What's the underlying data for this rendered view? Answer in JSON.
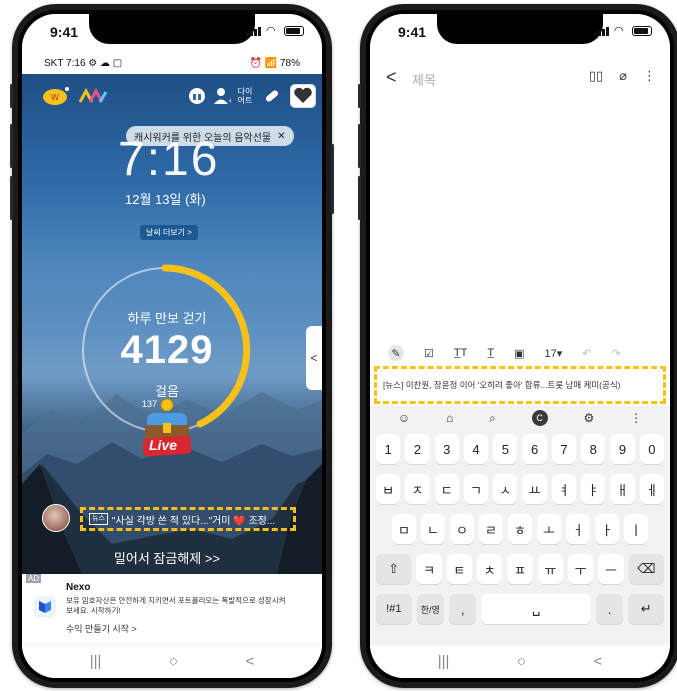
{
  "left_phone": {
    "ios_time": "9:41",
    "android_status_left": "SKT 7:16 ⚙ ☁ ▢",
    "android_status_right": "⏰ 📶 78%",
    "top_icons": [
      "cashwalk-logo-icon",
      "brand-icon",
      "gift-icon",
      "person-icon",
      "diet-label",
      "pill-icon",
      "heart-icon"
    ],
    "diet_label": "다이\n어트",
    "tooltip": "캐시워커를 위한 오늘의 음악선물",
    "tooltip_close": "✕",
    "clock": "7:16",
    "date": "12월 13일 (화)",
    "weather_button": "날씨 더보기 >",
    "walk_title": "하루 만보 걷기",
    "steps": "4129",
    "unit": "걸음",
    "minor_count": "137",
    "live_label": "Live",
    "news_tag": "뉴스",
    "news_text": "\"사실 각방 쓴 적 있다...\"거미 ❤️ 조정...",
    "unlock": "밀어서 잠금해제 >>",
    "ad_badge": "AD",
    "ad_title": "Nexo",
    "ad_text": "보유 암호자산은 안전하게 지키면서 포트폴리오는 폭발적으로 성장시켜 보세요. 시작하기!",
    "ad_cta": "수익 만들기 시작 >",
    "nav": [
      "|||",
      "○",
      "<"
    ]
  },
  "right_phone": {
    "ios_time": "9:41",
    "title_placeholder": "제목",
    "back": "<",
    "header_icons": [
      "book-icon",
      "attach-icon",
      "more-icon"
    ],
    "format_bar": [
      "pen-icon",
      "checkbox-icon",
      "text-style-icon",
      "underline-icon",
      "textbox-icon",
      "17▾",
      "undo-icon",
      "redo-icon"
    ],
    "font_size": "17▾",
    "draft_text": "[뉴스] 이찬원, 장윤정 이어 '오히려 좋아' 합류...트롯 남매 케미(공식)",
    "keyboard_tools": [
      "☺",
      "⌂",
      "⌕",
      "C",
      "⚙",
      "⋮"
    ],
    "row1": [
      "1",
      "2",
      "3",
      "4",
      "5",
      "6",
      "7",
      "8",
      "9",
      "0"
    ],
    "row2": [
      "ㅂ",
      "ㅈ",
      "ㄷ",
      "ㄱ",
      "ㅅ",
      "ㅛ",
      "ㅕ",
      "ㅑ",
      "ㅐ",
      "ㅔ"
    ],
    "row3": [
      "ㅁ",
      "ㄴ",
      "ㅇ",
      "ㄹ",
      "ㅎ",
      "ㅗ",
      "ㅓ",
      "ㅏ",
      "ㅣ"
    ],
    "row4": [
      "⇧",
      "ㅋ",
      "ㅌ",
      "ㅊ",
      "ㅍ",
      "ㅠ",
      "ㅜ",
      "ㅡ",
      "⌫"
    ],
    "row5": [
      "!#1",
      "한/영",
      ",",
      "␣",
      ".",
      "↵"
    ],
    "nav": [
      "|||",
      "○",
      "<"
    ]
  },
  "colors": {
    "highlight": "#f6c21a",
    "ring": "#f6c21a",
    "live_red": "#d9262f"
  }
}
